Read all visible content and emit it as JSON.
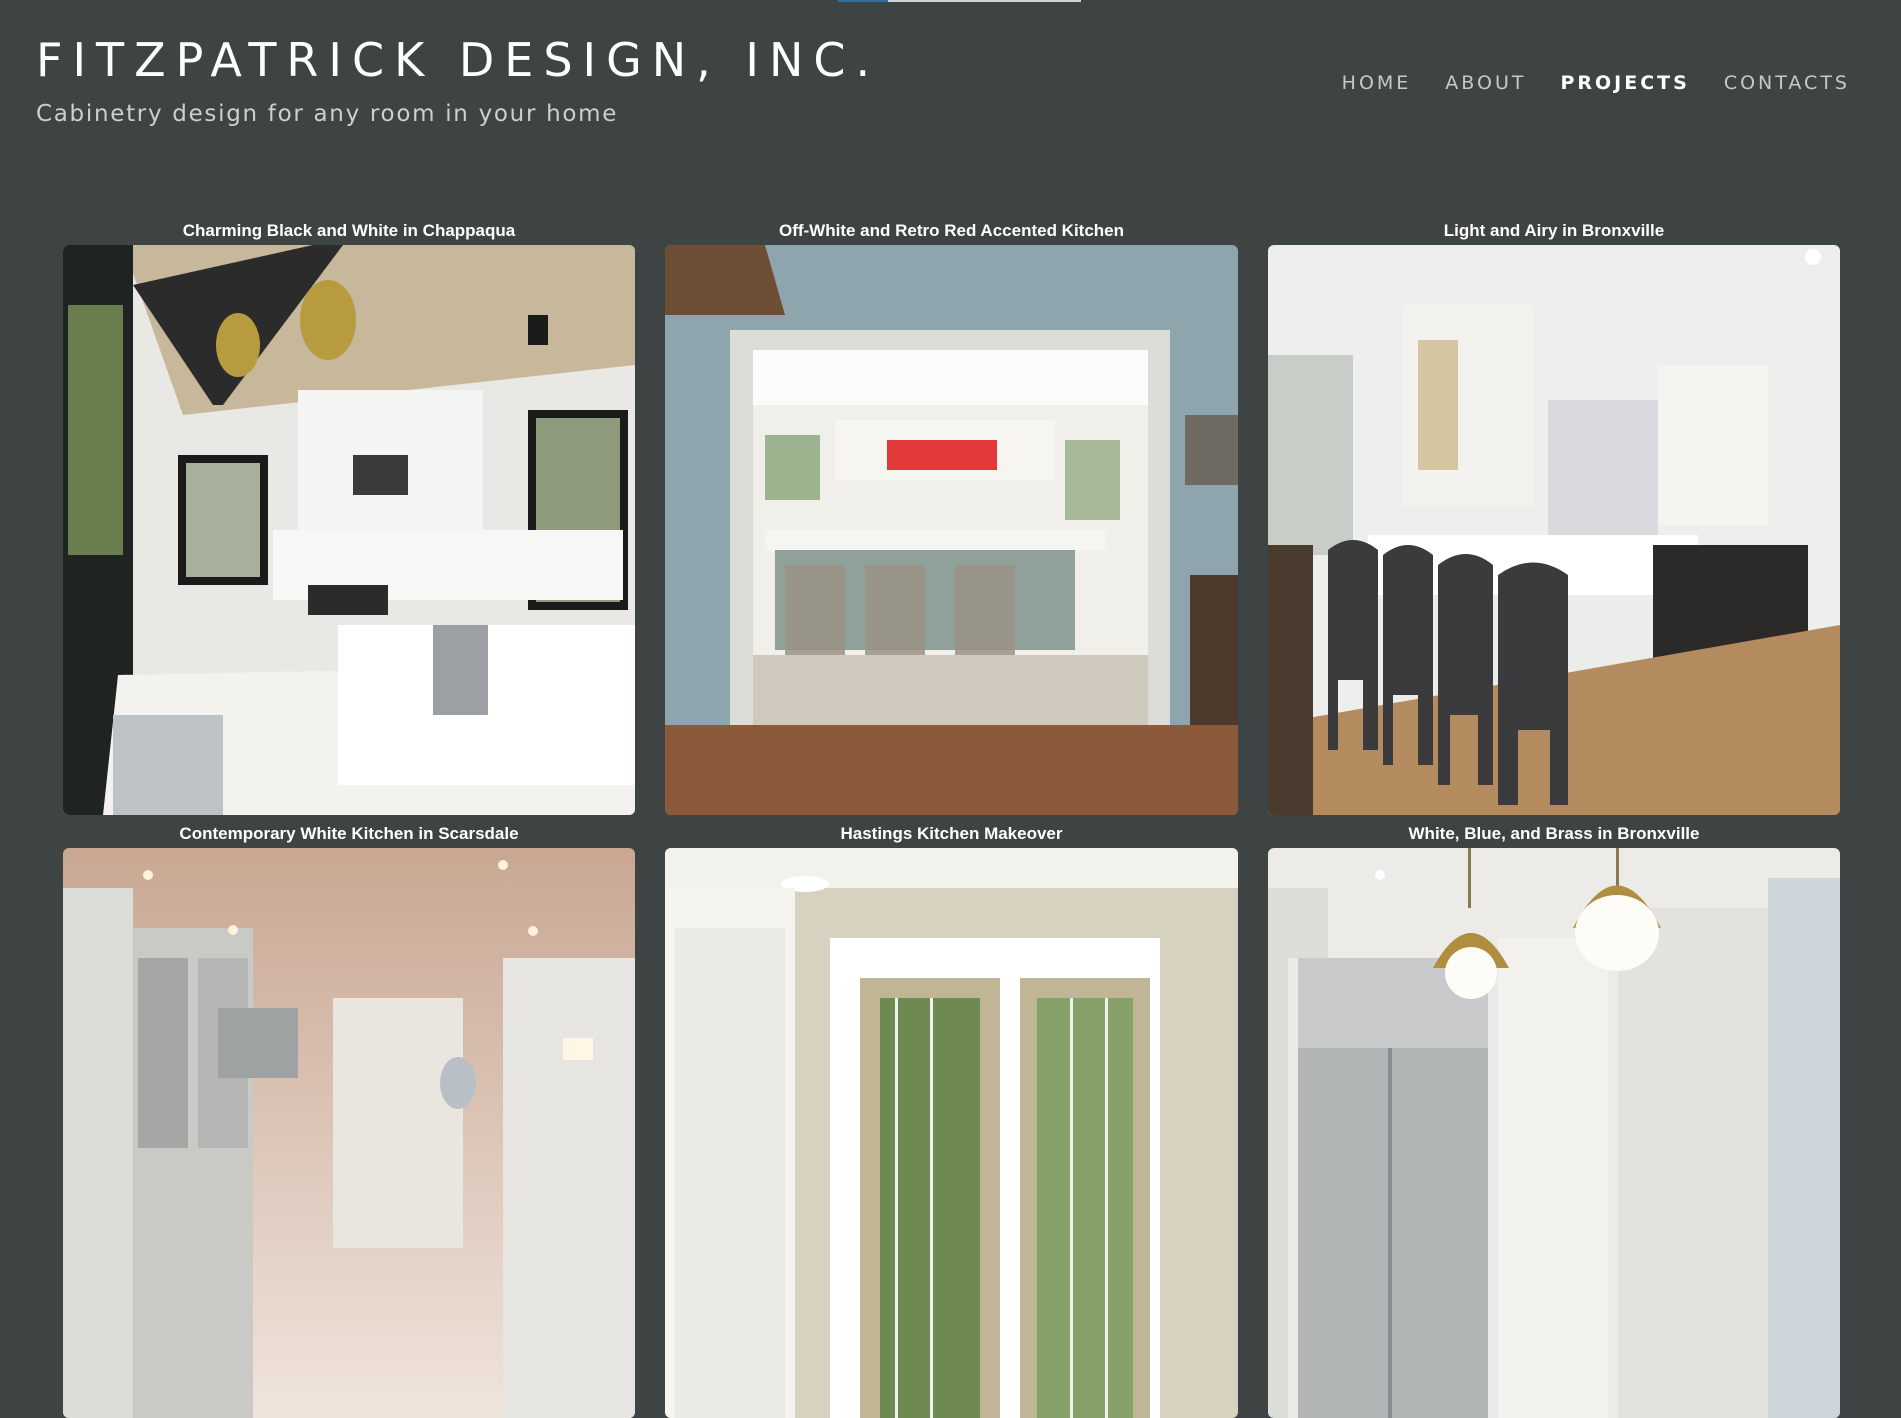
{
  "site": {
    "title": "FITZPATRICK DESIGN, INC.",
    "tagline": "Cabinetry design for any room in your home"
  },
  "nav": {
    "items": [
      {
        "label": "HOME"
      },
      {
        "label": "ABOUT"
      },
      {
        "label": "PROJECTS",
        "active": true
      },
      {
        "label": "CONTACTS"
      }
    ]
  },
  "projects": [
    {
      "title": "Charming Black and White in Chappaqua",
      "image": "kitchen-photo"
    },
    {
      "title": "Off-White and Retro Red Accented Kitchen",
      "image": "kitchen-photo"
    },
    {
      "title": "Light and Airy in Bronxville",
      "image": "kitchen-photo"
    },
    {
      "title": "Contemporary White Kitchen in Scarsdale",
      "image": "kitchen-photo"
    },
    {
      "title": "Hastings Kitchen Makeover",
      "image": "kitchen-photo"
    },
    {
      "title": "White, Blue, and Brass in Bronxville",
      "image": "kitchen-photo"
    }
  ],
  "colors": {
    "background": "#3e4443",
    "text_primary": "#ffffff",
    "text_muted": "#c3cbc9",
    "accent": "#2f6ea1"
  }
}
